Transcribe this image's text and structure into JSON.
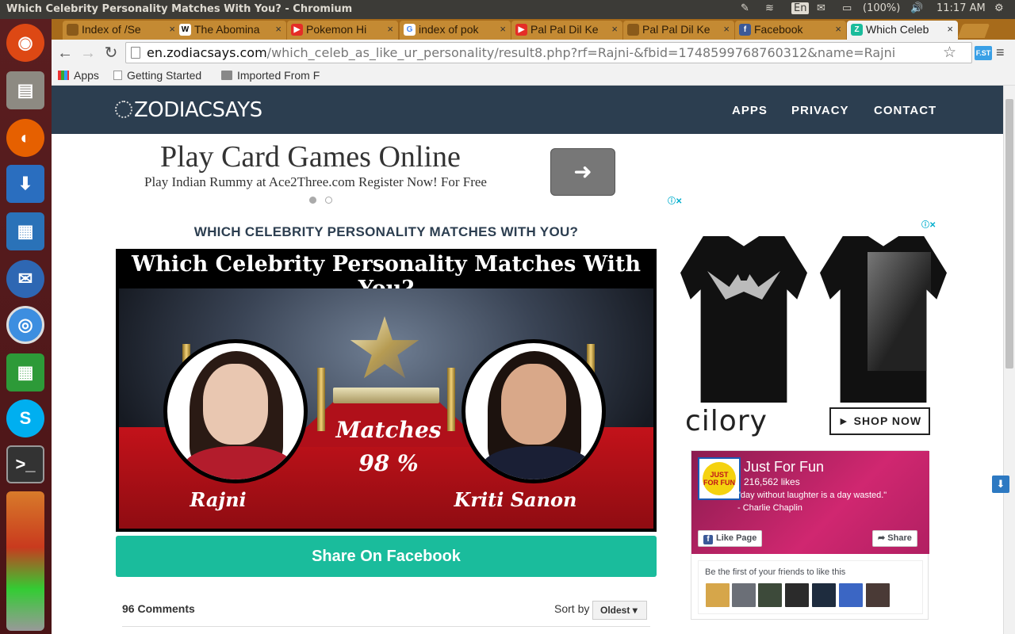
{
  "os": {
    "window_title": "Which Celebrity Personality Matches With You? - Chromium",
    "keyboard": "En",
    "battery": "(100%)",
    "time": "11:17 AM"
  },
  "launcher": {
    "apps": [
      "ubuntu-dash",
      "files",
      "firefox",
      "downloads",
      "writer",
      "thunderbird",
      "chromium",
      "calc",
      "skype",
      "terminal",
      "app-stack"
    ]
  },
  "tabs": [
    {
      "label": "Index of /Se",
      "icon": "doc-icon",
      "color": "#8a5a1a"
    },
    {
      "label": "The Abomina",
      "icon": "wikipedia-icon",
      "color": "#ffffff"
    },
    {
      "label": "Pokemon Hi",
      "icon": "youtube-icon",
      "color": "#e52d27"
    },
    {
      "label": "index of pok",
      "icon": "google-icon",
      "color": "#4285f4"
    },
    {
      "label": "Pal Pal Dil Ke",
      "icon": "youtube-icon",
      "color": "#e52d27"
    },
    {
      "label": "Pal Pal Dil Ke",
      "icon": "doc-icon",
      "color": "#8a5a1a"
    },
    {
      "label": "Facebook",
      "icon": "facebook-icon",
      "color": "#3b5998"
    },
    {
      "label": "Which Celeb",
      "icon": "zodiacsays-icon",
      "color": "#1abc9c",
      "active": true
    }
  ],
  "address": {
    "domain": "en.zodiacsays.com",
    "path": "/which_celeb_as_like_ur_personality/result8.php?rf=Rajni-&fbid=1748599768760312&name=Rajni"
  },
  "bookmarks": [
    "Apps",
    "Getting Started",
    "Imported From F"
  ],
  "site": {
    "logo": "ZODIACSAYS",
    "nav": [
      "APPS",
      "PRIVACY",
      "CONTACT"
    ]
  },
  "top_ad": {
    "title": "Play Card Games Online",
    "subtitle": "Play Indian Rummy at Ace2Three.com Register Now! For Free",
    "arrow": "➜"
  },
  "quiz": {
    "heading": "WHICH CELEBRITY PERSONALITY MATCHES WITH YOU?",
    "image_title": "Which Celebrity Personality Matches With You?",
    "user_name": "Rajni",
    "celebrity_name": "Kriti Sanon",
    "matches_label": "Matches",
    "match_percent": "98 %",
    "share_label": "Share On Facebook"
  },
  "comments": {
    "count_label": "96 Comments",
    "sort_label": "Sort by",
    "sort_value": "Oldest"
  },
  "side_ad": {
    "brand": "cilory",
    "cta": "► SHOP NOW"
  },
  "fb_page": {
    "name": "Just For Fun",
    "likes": "216,562 likes",
    "quote": "\"day without laughter is a day wasted.\"",
    "quote_author": "- Charlie Chaplin",
    "logo_text": "JUST FOR FUN",
    "like_label": "Like Page",
    "share_label": "Share",
    "friends_text": "Be the first of your friends to like this"
  }
}
